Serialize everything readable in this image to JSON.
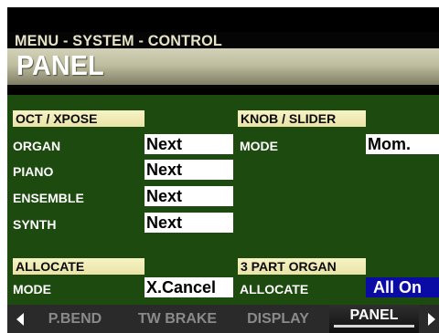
{
  "header": {
    "menu_path": "MENU - SYSTEM - CONTROL",
    "page_title": "PANEL"
  },
  "oct_xpose": {
    "title": "OCT / XPOSE",
    "rows": [
      {
        "label": "ORGAN",
        "value": "Next"
      },
      {
        "label": "PIANO",
        "value": "Next"
      },
      {
        "label": "ENSEMBLE",
        "value": "Next"
      },
      {
        "label": "SYNTH",
        "value": "Next"
      }
    ]
  },
  "knob_slider": {
    "title": "KNOB / SLIDER",
    "mode_label": "MODE",
    "mode_value": "Mom."
  },
  "allocate": {
    "title": "ALLOCATE",
    "mode_label": "MODE",
    "mode_value": "X.Cancel"
  },
  "three_part_organ": {
    "title": "3 PART ORGAN",
    "allocate_label": "ALLOCATE",
    "allocate_value": "All On"
  },
  "tabs": [
    {
      "label": "P.BEND",
      "active": false
    },
    {
      "label": "TW BRAKE",
      "active": false
    },
    {
      "label": "DISPLAY",
      "active": false
    },
    {
      "label": "PANEL",
      "active": true
    }
  ],
  "colors": {
    "panel_bg": "#1d4a0e",
    "section_header_bg": "#f3eeb8",
    "highlight_value_bg": "#0a0aa5",
    "tab_bar_bg": "#2a2a2a"
  }
}
